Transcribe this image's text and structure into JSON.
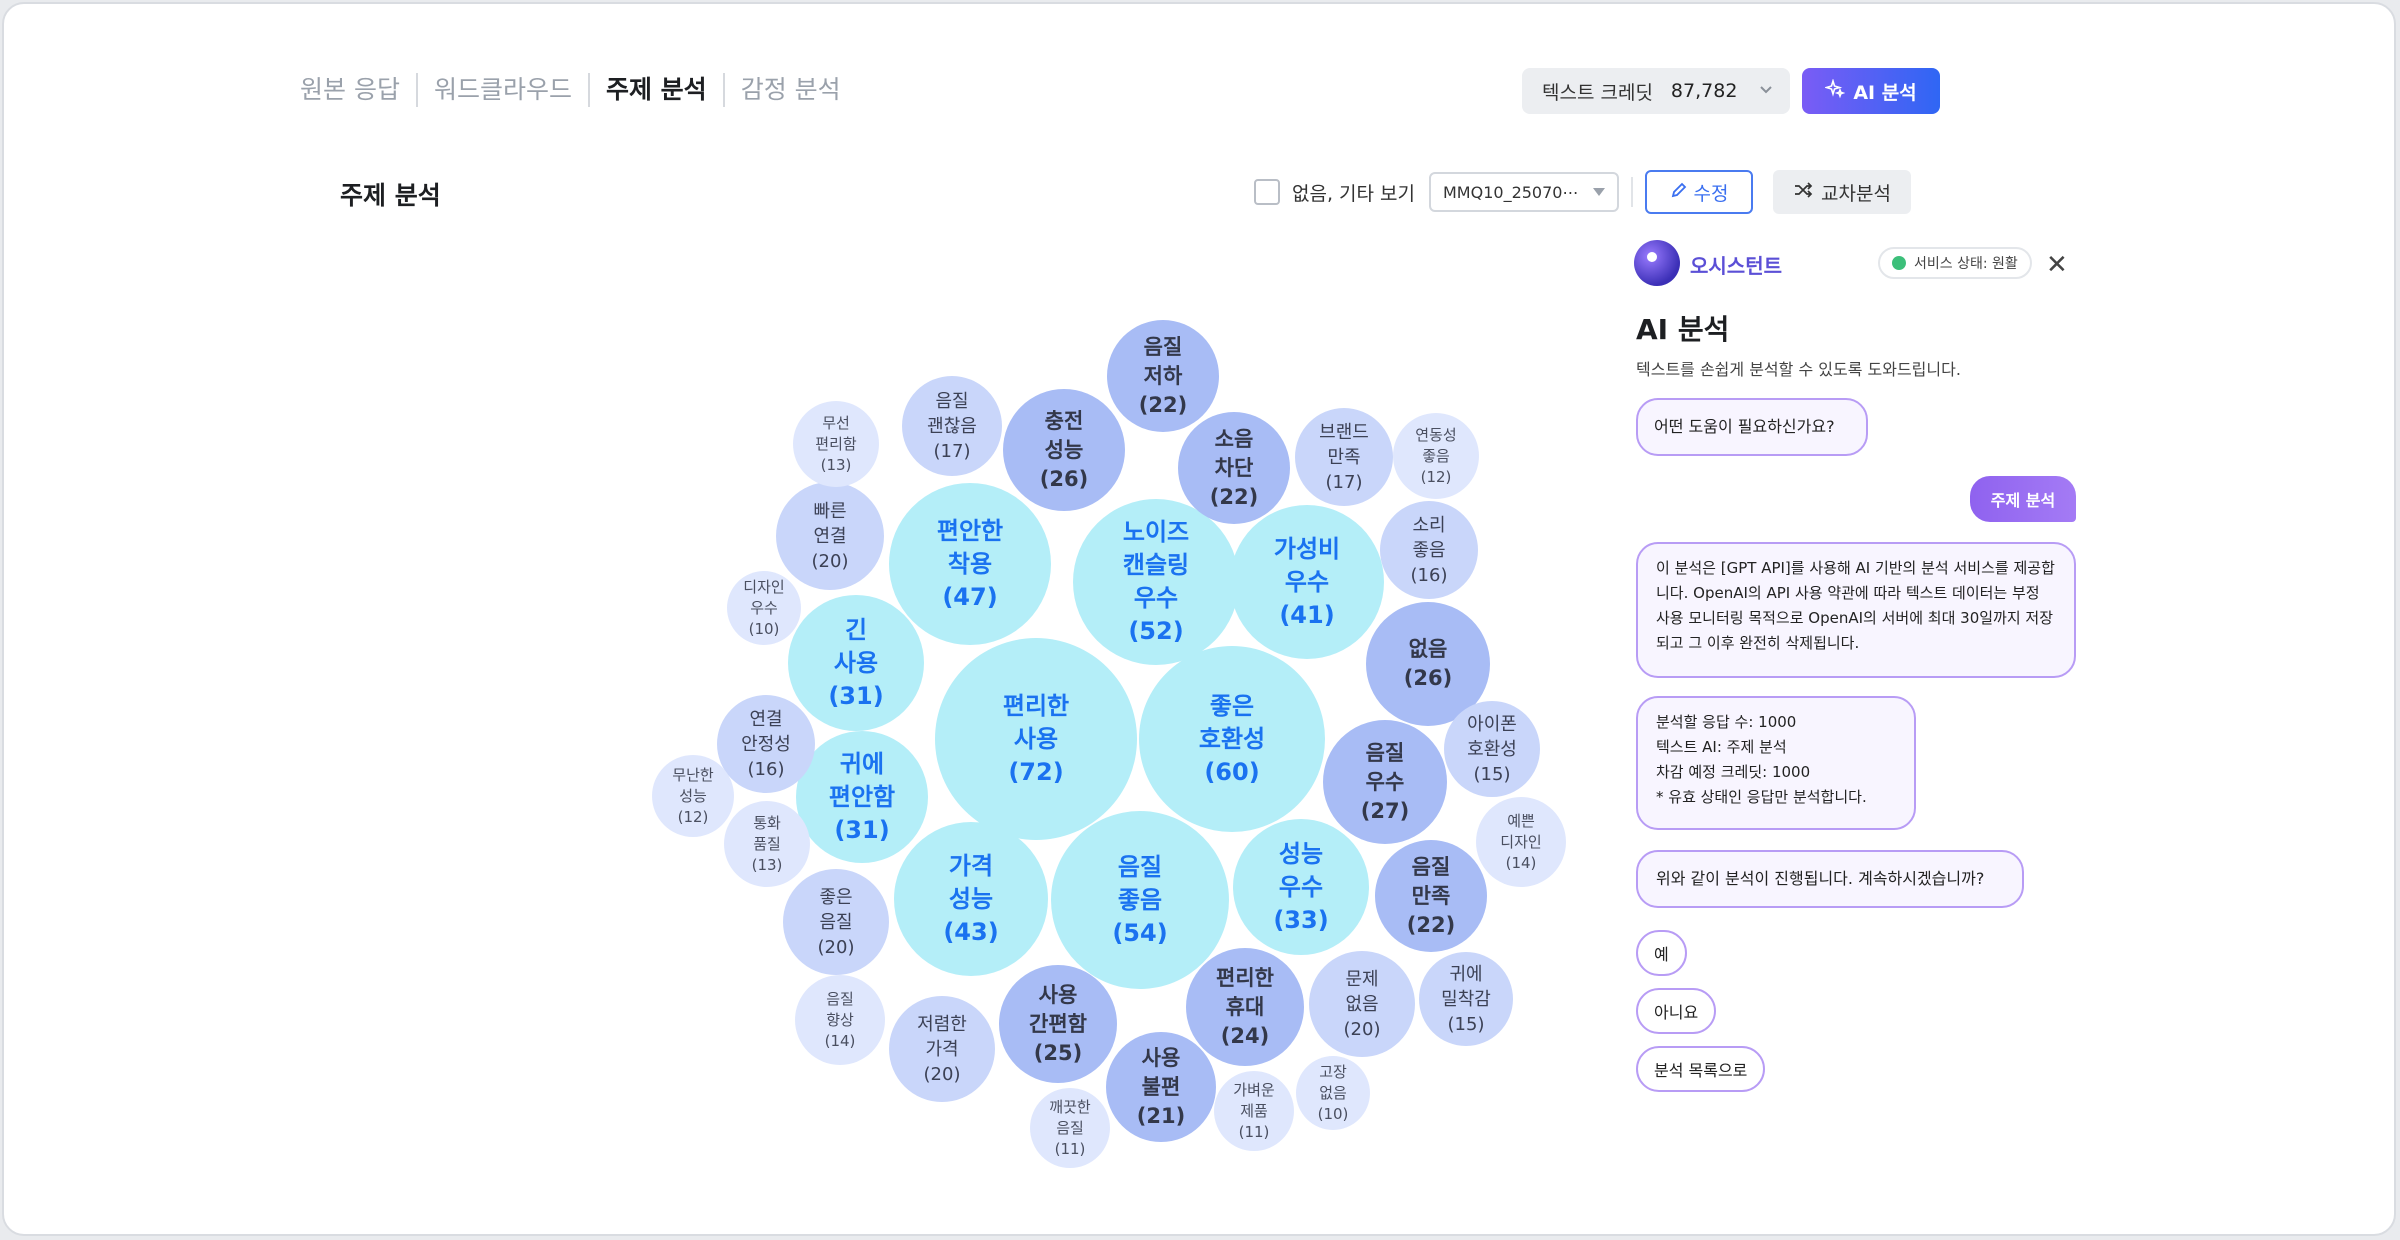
{
  "tabs": [
    {
      "label": "원본 응답",
      "active": false
    },
    {
      "label": "워드클라우드",
      "active": false
    },
    {
      "label": "주제 분석",
      "active": true
    },
    {
      "label": "감정 분석",
      "active": false
    }
  ],
  "credit": {
    "label": "텍스트 크레딧",
    "value": "87,782"
  },
  "ai_button": {
    "label": "AI 분석"
  },
  "section_title": "주제 분석",
  "toolbar": {
    "checkbox_label": "없음, 기타 보기",
    "select_value": "MMQ10_25070⋯",
    "edit_label": "수정",
    "cross_label": "교차분석"
  },
  "topics": [
    {
      "label": "편리한 사용",
      "count": "(72)",
      "size": "big"
    },
    {
      "label": "좋은 호환성",
      "count": "(60)",
      "size": "big"
    },
    {
      "label": "음질 좋음",
      "count": "(54)",
      "size": "big"
    },
    {
      "label": "노이즈 캔슬링 우수",
      "count": "(52)",
      "size": "big"
    },
    {
      "label": "편안한 착용",
      "count": "(47)",
      "size": "big"
    },
    {
      "label": "가격 성능",
      "count": "(43)",
      "size": "big"
    },
    {
      "label": "가성비 우수",
      "count": "(41)",
      "size": "big"
    },
    {
      "label": "성능 우수",
      "count": "(33)",
      "size": "big"
    },
    {
      "label": "긴 사용",
      "count": "(31)",
      "size": "big"
    },
    {
      "label": "귀에 편안함",
      "count": "(31)",
      "size": "big"
    },
    {
      "label": "음질 우수",
      "count": "(27)",
      "size": "mid"
    },
    {
      "label": "충전 성능",
      "count": "(26)",
      "size": "mid"
    },
    {
      "label": "없음",
      "count": "(26)",
      "size": "mid"
    },
    {
      "label": "사용 간편함",
      "count": "(25)",
      "size": "mid"
    },
    {
      "label": "편리한 휴대",
      "count": "(24)",
      "size": "mid"
    },
    {
      "label": "음질 저하",
      "count": "(22)",
      "size": "mid"
    },
    {
      "label": "소음 차단",
      "count": "(22)",
      "size": "mid"
    },
    {
      "label": "음질 만족",
      "count": "(22)",
      "size": "mid"
    },
    {
      "label": "사용 불편",
      "count": "(21)",
      "size": "mid"
    },
    {
      "label": "빠른 연결",
      "count": "(20)",
      "size": "sm"
    },
    {
      "label": "좋은 음질",
      "count": "(20)",
      "size": "sm"
    },
    {
      "label": "저렴한 가격",
      "count": "(20)",
      "size": "sm"
    },
    {
      "label": "문제 없음",
      "count": "(20)",
      "size": "sm"
    },
    {
      "label": "음질 괜찮음",
      "count": "(17)",
      "size": "sm"
    },
    {
      "label": "브랜드 만족",
      "count": "(17)",
      "size": "sm"
    },
    {
      "label": "소리 좋음",
      "count": "(16)",
      "size": "sm"
    },
    {
      "label": "연결 안정성",
      "count": "(16)",
      "size": "sm"
    },
    {
      "label": "아이폰 호환성",
      "count": "(15)",
      "size": "sm"
    },
    {
      "label": "귀에 밀착감",
      "count": "(15)",
      "size": "sm"
    },
    {
      "label": "음질 향상",
      "count": "(14)",
      "size": "xs"
    },
    {
      "label": "예쁜 디자인",
      "count": "(14)",
      "size": "xs"
    },
    {
      "label": "무선 편리함",
      "count": "(13)",
      "size": "xs"
    },
    {
      "label": "통화 품질",
      "count": "(13)",
      "size": "xs"
    },
    {
      "label": "연동성 좋음",
      "count": "(12)",
      "size": "xs"
    },
    {
      "label": "무난한 성능",
      "count": "(12)",
      "size": "xs"
    },
    {
      "label": "깨끗한 음질",
      "count": "(11)",
      "size": "xs"
    },
    {
      "label": "가벼운 제품",
      "count": "(11)",
      "size": "xs"
    },
    {
      "label": "디자인 우수",
      "count": "(10)",
      "size": "xs"
    },
    {
      "label": "고장 없음",
      "count": "(10)",
      "size": "xs"
    }
  ],
  "assistant": {
    "name": "오시스턴트",
    "status": "서비스 상태: 원활",
    "title": "AI 분석",
    "subtitle": "텍스트를 손쉽게 분석할 수 있도록 도와드립니다.",
    "greeting": "어떤 도움이 필요하신가요?",
    "user_message": "주제 분석",
    "notice": "이 분석은 [GPT API]를 사용해 AI 기반의 분석 서비스를 제공합니다. OpenAI의 API 사용 약관에 따라 텍스트 데이터는 부정 사용 모니터링 목적으로 OpenAI의 서버에 최대 30일까지 저장되고 그 이후 완전히 삭제됩니다.",
    "summary": [
      "분석할 응답 수: 1000",
      "텍스트 AI: 주제 분석",
      "차감 예정 크레딧: 1000",
      "* 유효 상태인 응답만 분석합니다."
    ],
    "confirm": "위와 같이 분석이 진행됩니다. 계속하시겠습니까?",
    "options": [
      "예",
      "아니요",
      "분석 목록으로"
    ]
  }
}
